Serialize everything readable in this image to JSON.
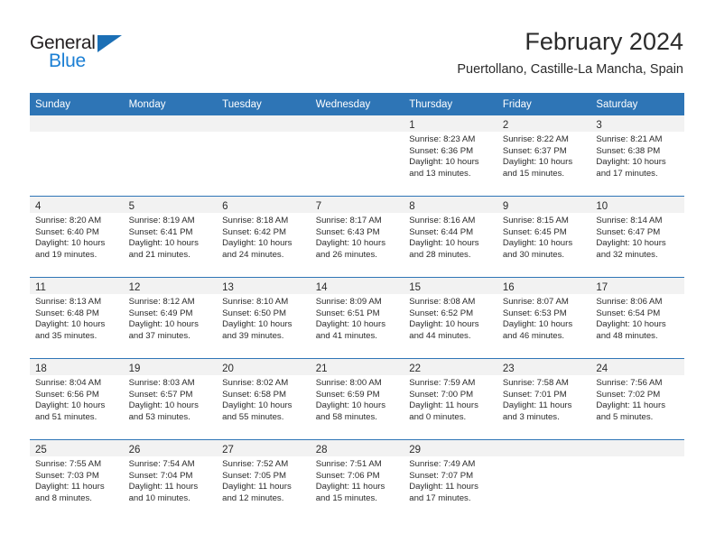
{
  "brand": {
    "name_part1": "General",
    "name_part2": "Blue",
    "triangle_icon": "triangle-icon",
    "color_dark": "#231f20",
    "color_blue": "#1b7fd4"
  },
  "header": {
    "month_title": "February 2024",
    "location": "Puertollano, Castille-La Mancha, Spain"
  },
  "theme": {
    "header_blue": "#2e75b6",
    "daynum_band": "#f2f2f2",
    "text": "#2b2b2b"
  },
  "calendar": {
    "weekday_headers": [
      "Sunday",
      "Monday",
      "Tuesday",
      "Wednesday",
      "Thursday",
      "Friday",
      "Saturday"
    ],
    "weeks": [
      [
        {
          "day": "",
          "sunrise": "",
          "sunset": "",
          "daylight_line1": "",
          "daylight_line2": ""
        },
        {
          "day": "",
          "sunrise": "",
          "sunset": "",
          "daylight_line1": "",
          "daylight_line2": ""
        },
        {
          "day": "",
          "sunrise": "",
          "sunset": "",
          "daylight_line1": "",
          "daylight_line2": ""
        },
        {
          "day": "",
          "sunrise": "",
          "sunset": "",
          "daylight_line1": "",
          "daylight_line2": ""
        },
        {
          "day": "1",
          "sunrise": "Sunrise: 8:23 AM",
          "sunset": "Sunset: 6:36 PM",
          "daylight_line1": "Daylight: 10 hours",
          "daylight_line2": "and 13 minutes."
        },
        {
          "day": "2",
          "sunrise": "Sunrise: 8:22 AM",
          "sunset": "Sunset: 6:37 PM",
          "daylight_line1": "Daylight: 10 hours",
          "daylight_line2": "and 15 minutes."
        },
        {
          "day": "3",
          "sunrise": "Sunrise: 8:21 AM",
          "sunset": "Sunset: 6:38 PM",
          "daylight_line1": "Daylight: 10 hours",
          "daylight_line2": "and 17 minutes."
        }
      ],
      [
        {
          "day": "4",
          "sunrise": "Sunrise: 8:20 AM",
          "sunset": "Sunset: 6:40 PM",
          "daylight_line1": "Daylight: 10 hours",
          "daylight_line2": "and 19 minutes."
        },
        {
          "day": "5",
          "sunrise": "Sunrise: 8:19 AM",
          "sunset": "Sunset: 6:41 PM",
          "daylight_line1": "Daylight: 10 hours",
          "daylight_line2": "and 21 minutes."
        },
        {
          "day": "6",
          "sunrise": "Sunrise: 8:18 AM",
          "sunset": "Sunset: 6:42 PM",
          "daylight_line1": "Daylight: 10 hours",
          "daylight_line2": "and 24 minutes."
        },
        {
          "day": "7",
          "sunrise": "Sunrise: 8:17 AM",
          "sunset": "Sunset: 6:43 PM",
          "daylight_line1": "Daylight: 10 hours",
          "daylight_line2": "and 26 minutes."
        },
        {
          "day": "8",
          "sunrise": "Sunrise: 8:16 AM",
          "sunset": "Sunset: 6:44 PM",
          "daylight_line1": "Daylight: 10 hours",
          "daylight_line2": "and 28 minutes."
        },
        {
          "day": "9",
          "sunrise": "Sunrise: 8:15 AM",
          "sunset": "Sunset: 6:45 PM",
          "daylight_line1": "Daylight: 10 hours",
          "daylight_line2": "and 30 minutes."
        },
        {
          "day": "10",
          "sunrise": "Sunrise: 8:14 AM",
          "sunset": "Sunset: 6:47 PM",
          "daylight_line1": "Daylight: 10 hours",
          "daylight_line2": "and 32 minutes."
        }
      ],
      [
        {
          "day": "11",
          "sunrise": "Sunrise: 8:13 AM",
          "sunset": "Sunset: 6:48 PM",
          "daylight_line1": "Daylight: 10 hours",
          "daylight_line2": "and 35 minutes."
        },
        {
          "day": "12",
          "sunrise": "Sunrise: 8:12 AM",
          "sunset": "Sunset: 6:49 PM",
          "daylight_line1": "Daylight: 10 hours",
          "daylight_line2": "and 37 minutes."
        },
        {
          "day": "13",
          "sunrise": "Sunrise: 8:10 AM",
          "sunset": "Sunset: 6:50 PM",
          "daylight_line1": "Daylight: 10 hours",
          "daylight_line2": "and 39 minutes."
        },
        {
          "day": "14",
          "sunrise": "Sunrise: 8:09 AM",
          "sunset": "Sunset: 6:51 PM",
          "daylight_line1": "Daylight: 10 hours",
          "daylight_line2": "and 41 minutes."
        },
        {
          "day": "15",
          "sunrise": "Sunrise: 8:08 AM",
          "sunset": "Sunset: 6:52 PM",
          "daylight_line1": "Daylight: 10 hours",
          "daylight_line2": "and 44 minutes."
        },
        {
          "day": "16",
          "sunrise": "Sunrise: 8:07 AM",
          "sunset": "Sunset: 6:53 PM",
          "daylight_line1": "Daylight: 10 hours",
          "daylight_line2": "and 46 minutes."
        },
        {
          "day": "17",
          "sunrise": "Sunrise: 8:06 AM",
          "sunset": "Sunset: 6:54 PM",
          "daylight_line1": "Daylight: 10 hours",
          "daylight_line2": "and 48 minutes."
        }
      ],
      [
        {
          "day": "18",
          "sunrise": "Sunrise: 8:04 AM",
          "sunset": "Sunset: 6:56 PM",
          "daylight_line1": "Daylight: 10 hours",
          "daylight_line2": "and 51 minutes."
        },
        {
          "day": "19",
          "sunrise": "Sunrise: 8:03 AM",
          "sunset": "Sunset: 6:57 PM",
          "daylight_line1": "Daylight: 10 hours",
          "daylight_line2": "and 53 minutes."
        },
        {
          "day": "20",
          "sunrise": "Sunrise: 8:02 AM",
          "sunset": "Sunset: 6:58 PM",
          "daylight_line1": "Daylight: 10 hours",
          "daylight_line2": "and 55 minutes."
        },
        {
          "day": "21",
          "sunrise": "Sunrise: 8:00 AM",
          "sunset": "Sunset: 6:59 PM",
          "daylight_line1": "Daylight: 10 hours",
          "daylight_line2": "and 58 minutes."
        },
        {
          "day": "22",
          "sunrise": "Sunrise: 7:59 AM",
          "sunset": "Sunset: 7:00 PM",
          "daylight_line1": "Daylight: 11 hours",
          "daylight_line2": "and 0 minutes."
        },
        {
          "day": "23",
          "sunrise": "Sunrise: 7:58 AM",
          "sunset": "Sunset: 7:01 PM",
          "daylight_line1": "Daylight: 11 hours",
          "daylight_line2": "and 3 minutes."
        },
        {
          "day": "24",
          "sunrise": "Sunrise: 7:56 AM",
          "sunset": "Sunset: 7:02 PM",
          "daylight_line1": "Daylight: 11 hours",
          "daylight_line2": "and 5 minutes."
        }
      ],
      [
        {
          "day": "25",
          "sunrise": "Sunrise: 7:55 AM",
          "sunset": "Sunset: 7:03 PM",
          "daylight_line1": "Daylight: 11 hours",
          "daylight_line2": "and 8 minutes."
        },
        {
          "day": "26",
          "sunrise": "Sunrise: 7:54 AM",
          "sunset": "Sunset: 7:04 PM",
          "daylight_line1": "Daylight: 11 hours",
          "daylight_line2": "and 10 minutes."
        },
        {
          "day": "27",
          "sunrise": "Sunrise: 7:52 AM",
          "sunset": "Sunset: 7:05 PM",
          "daylight_line1": "Daylight: 11 hours",
          "daylight_line2": "and 12 minutes."
        },
        {
          "day": "28",
          "sunrise": "Sunrise: 7:51 AM",
          "sunset": "Sunset: 7:06 PM",
          "daylight_line1": "Daylight: 11 hours",
          "daylight_line2": "and 15 minutes."
        },
        {
          "day": "29",
          "sunrise": "Sunrise: 7:49 AM",
          "sunset": "Sunset: 7:07 PM",
          "daylight_line1": "Daylight: 11 hours",
          "daylight_line2": "and 17 minutes."
        },
        {
          "day": "",
          "sunrise": "",
          "sunset": "",
          "daylight_line1": "",
          "daylight_line2": ""
        },
        {
          "day": "",
          "sunrise": "",
          "sunset": "",
          "daylight_line1": "",
          "daylight_line2": ""
        }
      ]
    ]
  }
}
